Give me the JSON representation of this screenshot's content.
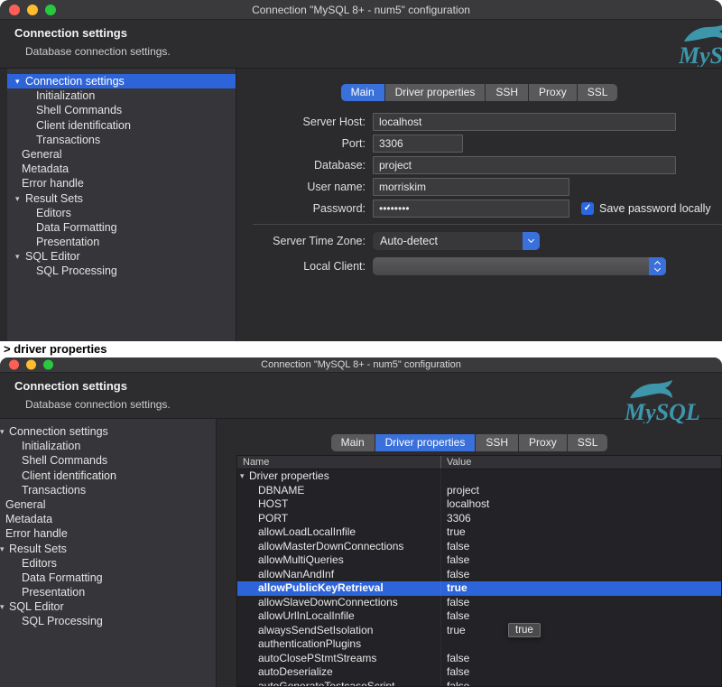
{
  "window_title": "Connection \"MySQL 8+ - num5\" configuration",
  "caption": "> driver properties",
  "header": {
    "title": "Connection settings",
    "subtitle": "Database connection settings."
  },
  "logo_text": "MySQL",
  "tabs": [
    "Main",
    "Driver properties",
    "SSH",
    "Proxy",
    "SSL"
  ],
  "top_window": {
    "selected_tab": 0,
    "sidebar_selected": 0
  },
  "bottom_window": {
    "selected_tab": 1,
    "sidebar_selected": -1
  },
  "sidebar_items": [
    {
      "label": "Connection settings",
      "level": 0,
      "expandable": true
    },
    {
      "label": "Initialization",
      "level": 1,
      "expandable": false
    },
    {
      "label": "Shell Commands",
      "level": 1,
      "expandable": false
    },
    {
      "label": "Client identification",
      "level": 1,
      "expandable": false
    },
    {
      "label": "Transactions",
      "level": 1,
      "expandable": false
    },
    {
      "label": "General",
      "level": 0,
      "expandable": false
    },
    {
      "label": "Metadata",
      "level": 0,
      "expandable": false
    },
    {
      "label": "Error handle",
      "level": 0,
      "expandable": false
    },
    {
      "label": "Result Sets",
      "level": 0,
      "expandable": true
    },
    {
      "label": "Editors",
      "level": 1,
      "expandable": false
    },
    {
      "label": "Data Formatting",
      "level": 1,
      "expandable": false
    },
    {
      "label": "Presentation",
      "level": 1,
      "expandable": false
    },
    {
      "label": "SQL Editor",
      "level": 0,
      "expandable": true
    },
    {
      "label": "SQL Processing",
      "level": 1,
      "expandable": false
    }
  ],
  "form": {
    "server_host": {
      "label": "Server Host:",
      "value": "localhost"
    },
    "port": {
      "label": "Port:",
      "value": "3306"
    },
    "database": {
      "label": "Database:",
      "value": "project"
    },
    "username": {
      "label": "User name:",
      "value": "morriskim"
    },
    "password": {
      "label": "Password:",
      "value": "••••••••"
    },
    "save_password": {
      "label": "Save password locally",
      "checked": true
    },
    "server_time_zone": {
      "label": "Server Time Zone:",
      "value": "Auto-detect"
    },
    "local_client": {
      "label": "Local Client:",
      "value": ""
    }
  },
  "driver_properties": {
    "columns": [
      "Name",
      "Value"
    ],
    "group_label": "Driver properties",
    "rows": [
      {
        "name": "DBNAME",
        "value": "project"
      },
      {
        "name": "HOST",
        "value": "localhost"
      },
      {
        "name": "PORT",
        "value": "3306"
      },
      {
        "name": "allowLoadLocalInfile",
        "value": "true"
      },
      {
        "name": "allowMasterDownConnections",
        "value": "false"
      },
      {
        "name": "allowMultiQueries",
        "value": "false"
      },
      {
        "name": "allowNanAndInf",
        "value": "false"
      },
      {
        "name": "allowPublicKeyRetrieval",
        "value": "true",
        "selected": true
      },
      {
        "name": "allowSlaveDownConnections",
        "value": "false"
      },
      {
        "name": "allowUrlInLocalInfile",
        "value": "false"
      },
      {
        "name": "alwaysSendSetIsolation",
        "value": "true"
      },
      {
        "name": "authenticationPlugins",
        "value": ""
      },
      {
        "name": "autoClosePStmtStreams",
        "value": "false"
      },
      {
        "name": "autoDeserialize",
        "value": "false"
      },
      {
        "name": "autoGenerateTestcaseScript",
        "value": "false"
      }
    ],
    "tooltip": "true"
  }
}
